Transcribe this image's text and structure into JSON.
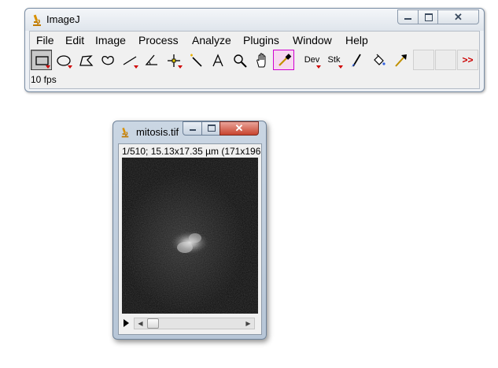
{
  "main_window": {
    "title": "ImageJ",
    "menu": [
      "File",
      "Edit",
      "Image",
      "Process",
      "Analyze",
      "Plugins",
      "Window",
      "Help"
    ],
    "tools": [
      {
        "name": "rectangle-tool",
        "selected": true
      },
      {
        "name": "oval-tool"
      },
      {
        "name": "polygon-tool"
      },
      {
        "name": "freehand-tool"
      },
      {
        "name": "line-tool"
      },
      {
        "name": "angle-tool"
      },
      {
        "name": "point-tool"
      },
      {
        "name": "wand-tool"
      },
      {
        "name": "text-tool"
      },
      {
        "name": "magnifier-tool"
      },
      {
        "name": "hand-tool"
      },
      {
        "name": "color-picker-tool"
      },
      {
        "name": "developer-menu",
        "label": "Dev"
      },
      {
        "name": "stacks-menu",
        "label": "Stk"
      },
      {
        "name": "brush-tool"
      },
      {
        "name": "flood-fill-tool"
      },
      {
        "name": "arrow-tool"
      },
      {
        "name": "more-tools",
        "label": ">>"
      }
    ],
    "status": "10 fps"
  },
  "image_window": {
    "title": "mitosis.tif",
    "info": "1/510; 15.13x17.35 µm (171x196"
  },
  "colors": {
    "picker_highlight": "#d000d0",
    "close_red": "#c8442e",
    "dropdown_arrow": "#d00000"
  }
}
